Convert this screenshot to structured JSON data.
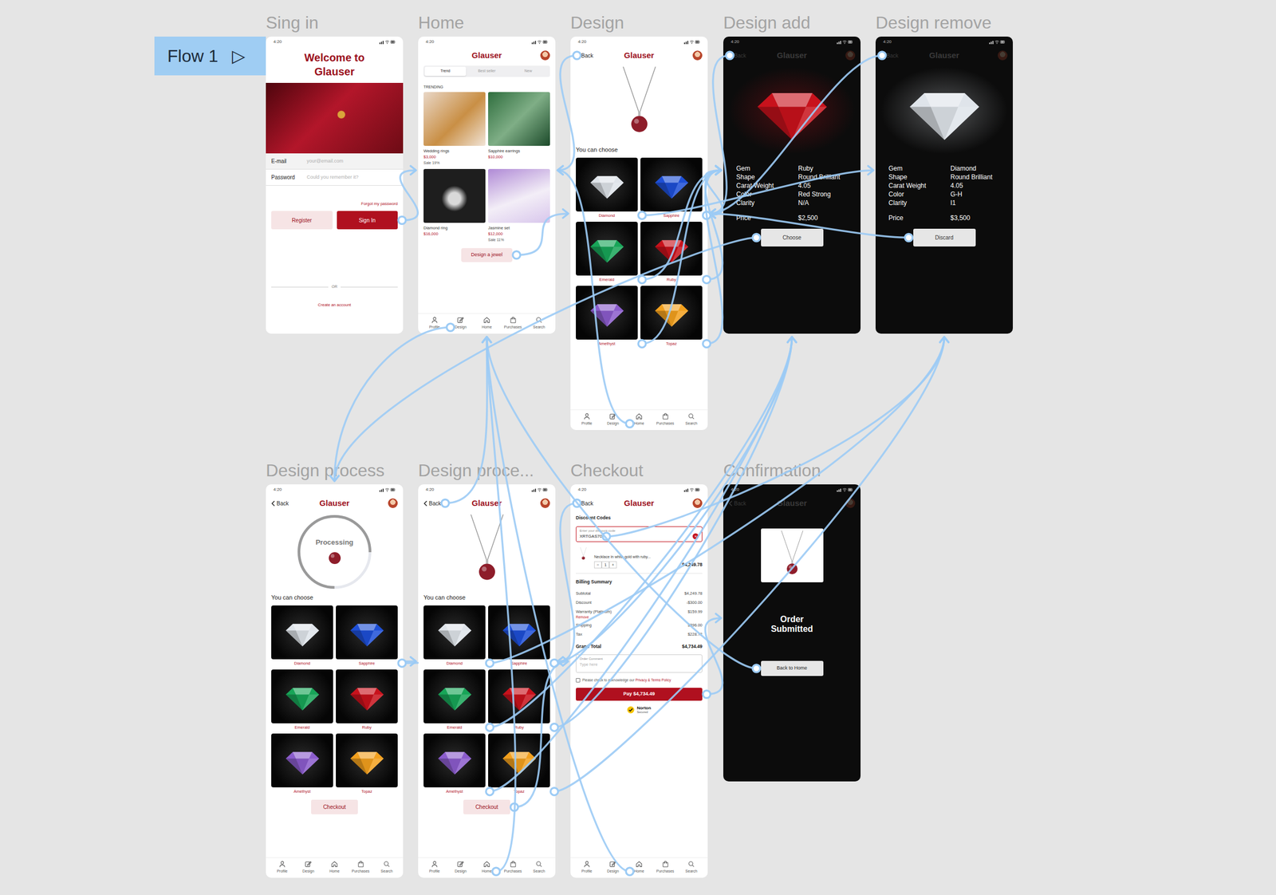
{
  "flow": {
    "label": "Flow 1",
    "icon": "▷"
  },
  "frames": [
    {
      "title": "Sing in",
      "kind": "signin",
      "time": "4:20",
      "heading": "Welcome to Glauser",
      "fields": [
        {
          "label": "E-mail",
          "placeholder": "your@email.com"
        },
        {
          "label": "Password",
          "placeholder": "Could you remember it?"
        }
      ],
      "forgot": "Forgot my password",
      "buttons": [
        {
          "label": "Register",
          "kind": "secondary"
        },
        {
          "label": "Sign In",
          "kind": "primary"
        }
      ],
      "divider": "OR",
      "create": "Create an account"
    },
    {
      "title": "Home",
      "kind": "home",
      "time": "4:20",
      "brand": "Glauser",
      "tabs": [
        {
          "label": "Trend",
          "selected": true
        },
        {
          "label": "Best seller",
          "selected": false
        },
        {
          "label": "New",
          "selected": false
        }
      ],
      "section": "TRENDING",
      "products": [
        {
          "name": "Wedding rings",
          "price": "$3,000",
          "sale": "Sale 19%"
        },
        {
          "name": "Sapphire earrings",
          "price": "$10,000"
        },
        {
          "name": "Diamond ring",
          "price": "$16,000"
        },
        {
          "name": "Jasmine set",
          "price": "$12,000",
          "sale": "Sale 11%"
        }
      ],
      "cta": "Design a jewel",
      "nav": [
        {
          "label": "Profile"
        },
        {
          "label": "Design"
        },
        {
          "label": "Home"
        },
        {
          "label": "Purchases"
        },
        {
          "label": "Search"
        }
      ]
    },
    {
      "title": "Design",
      "kind": "design",
      "time": "4:20",
      "back": "Back",
      "brand": "Glauser",
      "section": "You can choose",
      "gems": [
        {
          "name": "Diamond",
          "color": "#dfe4ea"
        },
        {
          "name": "Sapphire",
          "color": "#1e4fd6"
        },
        {
          "name": "Emerald",
          "color": "#18a558"
        },
        {
          "name": "Ruby",
          "color": "#c8121c"
        },
        {
          "name": "Amethyst",
          "color": "#8b5ccc"
        },
        {
          "name": "Topaz",
          "color": "#f2a01e"
        }
      ],
      "nav": [
        {
          "label": "Profile"
        },
        {
          "label": "Design"
        },
        {
          "label": "Home"
        },
        {
          "label": "Purchases"
        },
        {
          "label": "Search"
        }
      ]
    },
    {
      "title": "Design add",
      "kind": "detail",
      "time": "4:20",
      "back": "Back",
      "brand": "Glauser",
      "color": "#c8121c",
      "specs": [
        {
          "label": "Gem",
          "value": "Ruby"
        },
        {
          "label": "Shape",
          "value": "Round Brilliant"
        },
        {
          "label": "Carat Weight",
          "value": "4.05"
        },
        {
          "label": "Color",
          "value": "Red Strong"
        },
        {
          "label": "Clarity",
          "value": "N/A"
        }
      ],
      "price": {
        "label": "Price",
        "value": "$2,500"
      },
      "button": "Choose"
    },
    {
      "title": "Design remove",
      "kind": "detail",
      "time": "4:20",
      "back": "Back",
      "brand": "Glauser",
      "color": "#dfe4ea",
      "specs": [
        {
          "label": "Gem",
          "value": "Diamond"
        },
        {
          "label": "Shape",
          "value": "Round Brilliant"
        },
        {
          "label": "Carat Weight",
          "value": "4.05"
        },
        {
          "label": "Color",
          "value": "G-H"
        },
        {
          "label": "Clarity",
          "value": "I1"
        }
      ],
      "price": {
        "label": "Price",
        "value": "$3,500"
      },
      "button": "Discard"
    },
    {
      "title": "Design process",
      "kind": "process",
      "time": "4:20",
      "back": "Back",
      "brand": "Glauser",
      "status": "Processing",
      "level": 0.75,
      "section": "You can choose",
      "gems": [
        {
          "name": "Diamond",
          "color": "#dfe4ea"
        },
        {
          "name": "Sapphire",
          "color": "#1e4fd6"
        },
        {
          "name": "Emerald",
          "color": "#18a558"
        },
        {
          "name": "Ruby",
          "color": "#c8121c"
        },
        {
          "name": "Amethyst",
          "color": "#8b5ccc"
        },
        {
          "name": "Topaz",
          "color": "#f2a01e"
        }
      ],
      "checkout": "Checkout",
      "nav": [
        {
          "label": "Profile"
        },
        {
          "label": "Design"
        },
        {
          "label": "Home"
        },
        {
          "label": "Purchases"
        },
        {
          "label": "Search"
        }
      ]
    },
    {
      "title": "Design proce...",
      "kind": "design2",
      "time": "4:20",
      "back": "Back",
      "brand": "Glauser",
      "section": "You can choose",
      "gems": [
        {
          "name": "Diamond",
          "color": "#dfe4ea"
        },
        {
          "name": "Sapphire",
          "color": "#1e4fd6"
        },
        {
          "name": "Emerald",
          "color": "#18a558"
        },
        {
          "name": "Ruby",
          "color": "#c8121c"
        },
        {
          "name": "Amethyst",
          "color": "#8b5ccc"
        },
        {
          "name": "Topaz",
          "color": "#f2a01e"
        }
      ],
      "checkout": "Checkout",
      "nav": [
        {
          "label": "Profile"
        },
        {
          "label": "Design"
        },
        {
          "label": "Home"
        },
        {
          "label": "Purchases"
        },
        {
          "label": "Search"
        }
      ]
    },
    {
      "title": "Checkout",
      "kind": "checkout",
      "time": "4:20",
      "back": "Back",
      "brand": "Glauser",
      "discount": {
        "title": "Discount Codes",
        "label": "Enter your discount code",
        "value": "XRTGAS70",
        "clear": "×"
      },
      "item": {
        "name": "Necklace in white gold with ruby...",
        "minus": "−",
        "qty": "1",
        "plus": "+",
        "price": "$4,249.78"
      },
      "billing": {
        "title": "Billing Summary",
        "rows": [
          {
            "label": "Subtotal",
            "value": "$4,249.78"
          },
          {
            "label": "Discount",
            "value": "-$300.00"
          },
          {
            "label": "Warranty (Platinum)",
            "value": "$159.99",
            "action": "Remove"
          },
          {
            "label": "Shipping",
            "value": "$396.00"
          },
          {
            "label": "Tax",
            "value": "$228.72"
          }
        ]
      },
      "total": {
        "label": "Grand Total",
        "value": "$4,734.49"
      },
      "comment": {
        "label": "Order Comment",
        "placeholder": "Type here"
      },
      "terms": {
        "text": "Please check to acknowledge our",
        "link": "Privacy & Terms Policy",
        "checked": false
      },
      "pay": "Pay $4,734.49",
      "badge": {
        "brand": "Norton",
        "sub": "Secured"
      },
      "nav": [
        {
          "label": "Profile"
        },
        {
          "label": "Design"
        },
        {
          "label": "Home"
        },
        {
          "label": "Purchases"
        },
        {
          "label": "Search"
        }
      ]
    },
    {
      "title": "Confirmation",
      "kind": "confirm",
      "time": "4:20",
      "back": "Back",
      "brand": "Glauser",
      "message": "Order Submitted",
      "button": "Back to Home"
    }
  ],
  "connections": [
    {
      "from": "frames.0.buttons.1.label",
      "to": 1
    },
    {
      "from": "frames.1.cta",
      "to": 2
    },
    {
      "from": "frames.1.nav.1.label",
      "to": 5
    },
    {
      "from": "frames.2.back",
      "to": 1
    },
    {
      "from": "frames.2.gems.0.name",
      "to": 4
    },
    {
      "from": "frames.2.gems.1.name",
      "to": 3
    },
    {
      "from": "frames.2.gems.2.name",
      "to": 3
    },
    {
      "from": "frames.2.gems.3.name",
      "to": 3
    },
    {
      "from": "frames.2.gems.4.name",
      "to": 3
    },
    {
      "from": "frames.2.gems.5.name",
      "to": 3
    },
    {
      "from": "frames.2.nav.2.label",
      "to": 1
    },
    {
      "from": "frames.3.button",
      "to": 5
    },
    {
      "from": "frames.3.back",
      "to": 2
    },
    {
      "from": "frames.4.button",
      "to": 2
    },
    {
      "from": "frames.4.back",
      "to": 2
    },
    {
      "from": "frames.5.gems.1.name",
      "to": 6
    },
    {
      "from": "frames.6.back",
      "to": 1
    },
    {
      "from": "frames.6.gems.0.name",
      "to": 4
    },
    {
      "from": "frames.6.gems.1.name",
      "to": 3
    },
    {
      "from": "frames.6.gems.2.name",
      "to": 3
    },
    {
      "from": "frames.6.gems.3.name",
      "to": 3
    },
    {
      "from": "frames.6.gems.4.name",
      "to": 3
    },
    {
      "from": "frames.6.gems.5.name",
      "to": 4
    },
    {
      "from": "frames.6.checkout",
      "to": 7
    },
    {
      "from": "frames.6.nav.2.label",
      "to": 1
    },
    {
      "from": "frames.7.back",
      "to": 6
    },
    {
      "from": "frames.7.discount.value",
      "to": 4
    },
    {
      "from": "frames.7.pay",
      "to": 8
    },
    {
      "from": "frames.7.nav.2.label",
      "to": 1
    },
    {
      "from": "frames.8.button",
      "to": 1
    }
  ]
}
